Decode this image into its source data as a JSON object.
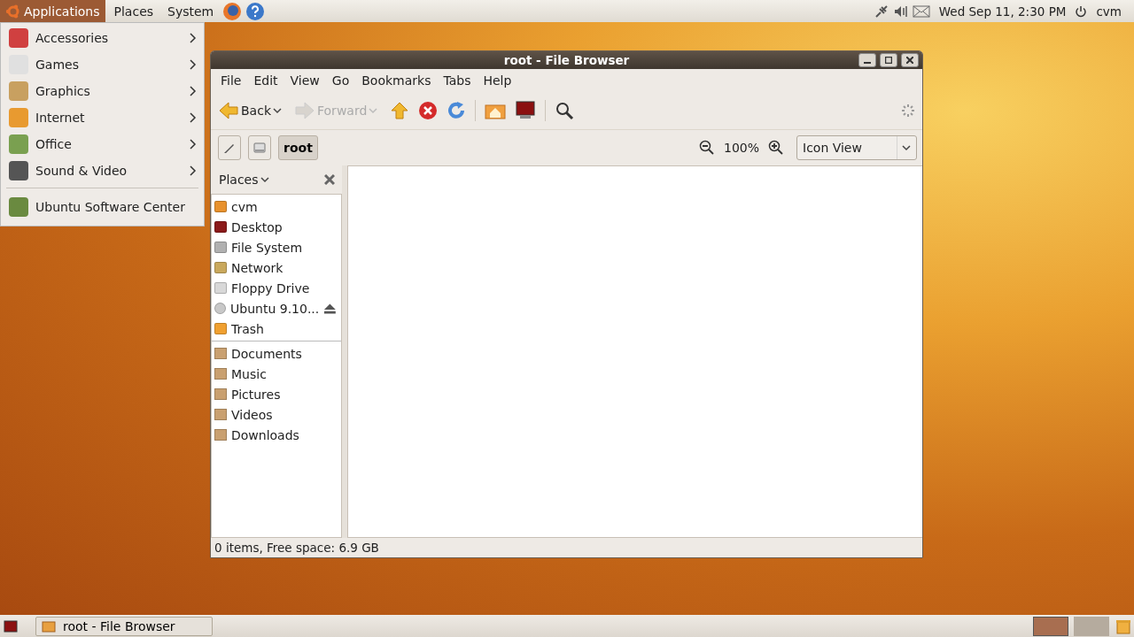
{
  "top_panel": {
    "menus": [
      {
        "label": "Applications",
        "selected": true
      },
      {
        "label": "Places",
        "selected": false
      },
      {
        "label": "System",
        "selected": false
      }
    ],
    "clock": "Wed Sep 11,  2:30 PM",
    "user": "cvm"
  },
  "apps_menu": {
    "items": [
      {
        "label": "Accessories",
        "submenu": true
      },
      {
        "label": "Games",
        "submenu": true
      },
      {
        "label": "Graphics",
        "submenu": true
      },
      {
        "label": "Internet",
        "submenu": true
      },
      {
        "label": "Office",
        "submenu": true
      },
      {
        "label": "Sound & Video",
        "submenu": true
      }
    ],
    "extra": [
      {
        "label": "Ubuntu Software Center",
        "submenu": false
      }
    ]
  },
  "window": {
    "title": "root - File Browser",
    "menu": [
      "File",
      "Edit",
      "View",
      "Go",
      "Bookmarks",
      "Tabs",
      "Help"
    ],
    "toolbar": [
      {
        "label": "Back",
        "disabled": false
      },
      {
        "label": "Forward",
        "disabled": true
      }
    ],
    "location": {
      "path": [
        {
          "label": "root",
          "selected": true
        }
      ],
      "zoom": "100%",
      "view": "Icon View"
    },
    "sidebar": {
      "header": "Places",
      "places": [
        {
          "label": "cvm",
          "ejectable": false
        },
        {
          "label": "Desktop",
          "ejectable": false
        },
        {
          "label": "File System",
          "ejectable": false
        },
        {
          "label": "Network",
          "ejectable": false
        },
        {
          "label": "Floppy Drive",
          "ejectable": false
        },
        {
          "label": "Ubuntu 9.10...",
          "ejectable": true
        },
        {
          "label": "Trash",
          "ejectable": false
        }
      ],
      "bookmarks": [
        {
          "label": "Documents"
        },
        {
          "label": "Music"
        },
        {
          "label": "Pictures"
        },
        {
          "label": "Videos"
        },
        {
          "label": "Downloads"
        }
      ]
    },
    "status": "0 items, Free space: 6.9 GB"
  },
  "taskbar": {
    "tasks": [
      {
        "label": "root - File Browser",
        "selected": false
      }
    ]
  }
}
